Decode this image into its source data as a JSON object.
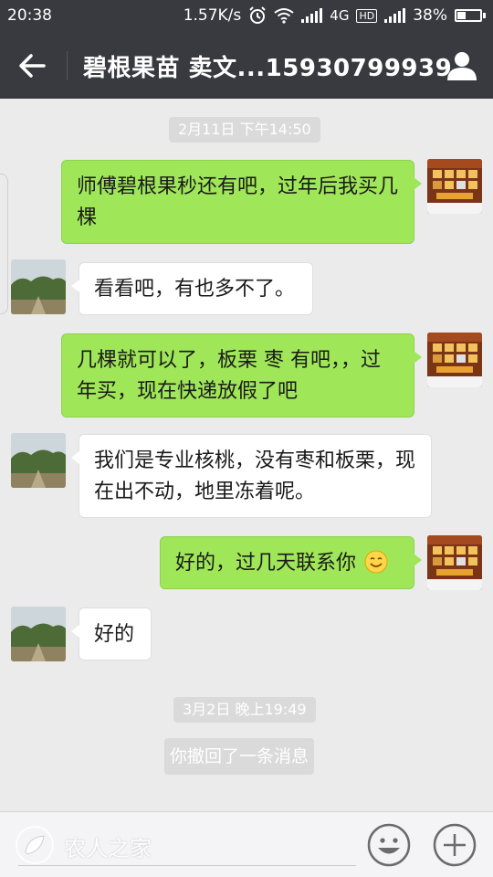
{
  "status_bar": {
    "time": "20:38",
    "net_speed": "1.57K/s",
    "network": "4G",
    "hd": "HD",
    "battery": "38%",
    "battery_level": 0.38
  },
  "header": {
    "back_icon": "arrow-left-icon",
    "title": "碧根果苗  卖文...15930799939",
    "profile_icon": "person-icon"
  },
  "chat": {
    "timestamp_1": "2月11日 下午14:50",
    "messages": [
      {
        "side": "out",
        "text": "师傅碧根果秒还有吧，过年后我买几棵"
      },
      {
        "side": "in",
        "text": "看看吧，有也多不了。"
      },
      {
        "side": "out",
        "text": "几棵就可以了，板栗  枣  有吧，，过年买，现在快递放假了吧"
      },
      {
        "side": "in",
        "text": "我们是专业核桃，没有枣和板栗，现在出不动，地里冻着呢。"
      },
      {
        "side": "out",
        "text": "好的，过几天联系你",
        "emoji": "smile-emoji-icon"
      },
      {
        "side": "in",
        "text": "好的"
      }
    ],
    "timestamp_2": "3月2日 晚上19:49",
    "recall_notice": "你撤回了一条消息"
  },
  "input_bar": {
    "watermark": "农人之家",
    "emoji_icon": "smiley-face-icon",
    "plus_icon": "plus-circle-icon"
  },
  "colors": {
    "header_bg": "#393a3f",
    "chat_bg": "#ebebeb",
    "out_bubble": "#9fe658",
    "in_bubble": "#ffffff"
  }
}
